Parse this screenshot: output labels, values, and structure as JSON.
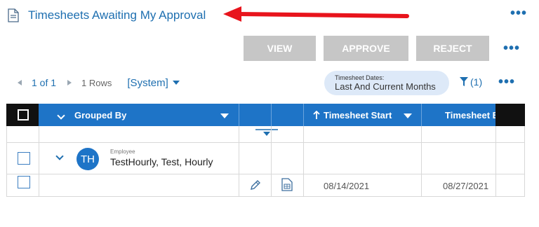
{
  "header": {
    "title": "Timesheets Awaiting My Approval",
    "title_icon": "document-icon",
    "more_icon": "more-horizontal-icon"
  },
  "annotation": {
    "color": "#e8141c"
  },
  "actions": {
    "view": "VIEW",
    "approve": "APPROVE",
    "reject": "REJECT"
  },
  "pager": {
    "page_of": "1 of 1",
    "rows": "1 Rows",
    "view_name": "[System]"
  },
  "filter_pill": {
    "label": "Timesheet Dates:",
    "value": "Last And Current Months"
  },
  "filter": {
    "count": "(1)"
  },
  "grid": {
    "columns": [
      "Grouped By",
      "Timesheet Start",
      "Timesheet E"
    ],
    "group_row": {
      "initials": "TH",
      "label": "Employee",
      "name": "TestHourly, Test, Hourly"
    },
    "data_row": {
      "timesheet_start": "08/14/2021",
      "timesheet_end": "08/27/2021"
    }
  },
  "colors": {
    "accent": "#1e6fb0",
    "header_blue": "#1e74c7",
    "disabled_button": "#c6c6c6"
  }
}
